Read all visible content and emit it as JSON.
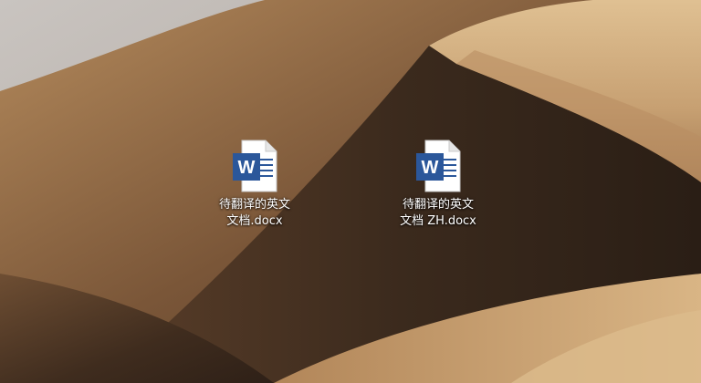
{
  "desktop": {
    "icons": [
      {
        "icon": "word-document-icon",
        "label_line1": "待翻译的英文",
        "label_line2": "文档.docx",
        "badge_letter": "W"
      },
      {
        "icon": "word-document-icon",
        "label_line1": "待翻译的英文",
        "label_line2": "文档 ZH.docx",
        "badge_letter": "W"
      }
    ]
  },
  "colors": {
    "word_blue": "#2b579a",
    "sand_light": "#d8b68a",
    "sand_dark": "#3a2a1c",
    "sky": "#a9a9ae"
  }
}
